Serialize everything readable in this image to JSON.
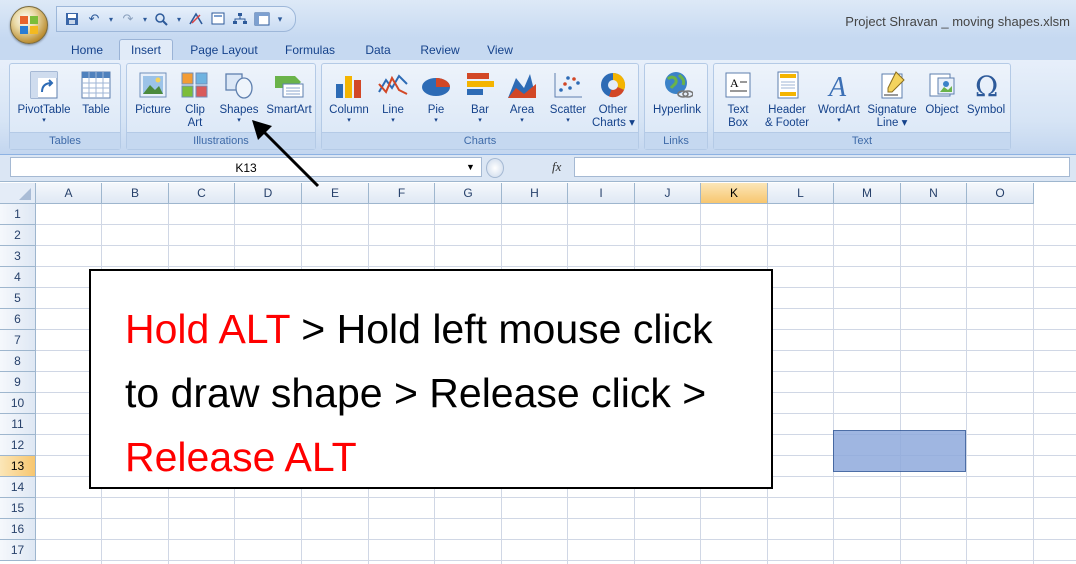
{
  "window": {
    "title": "Project Shravan _ moving shapes.xlsm",
    "quick_access": [
      "save-icon",
      "undo-icon",
      "redo-icon",
      "spelling-icon",
      "sort-icon",
      "print-preview-icon",
      "org-chart-icon",
      "freeze-panes-icon"
    ]
  },
  "tabs": [
    "Home",
    "Insert",
    "Page Layout",
    "Formulas",
    "Data",
    "Review",
    "View"
  ],
  "active_tab": "Insert",
  "ribbon": {
    "tables": {
      "label": "Tables",
      "pivottable": "PivotTable",
      "table": "Table"
    },
    "illustrations": {
      "label": "Illustrations",
      "picture": "Picture",
      "clipart_1": "Clip",
      "clipart_2": "Art",
      "shapes": "Shapes",
      "smartart": "SmartArt"
    },
    "charts": {
      "label": "Charts",
      "column": "Column",
      "line": "Line",
      "pie": "Pie",
      "bar": "Bar",
      "area": "Area",
      "scatter": "Scatter",
      "other_1": "Other",
      "other_2": "Charts"
    },
    "links": {
      "label": "Links",
      "hyperlink": "Hyperlink"
    },
    "text": {
      "label": "Text",
      "textbox_1": "Text",
      "textbox_2": "Box",
      "header_1": "Header",
      "header_2": "& Footer",
      "wordart": "WordArt",
      "signature_1": "Signature",
      "signature_2": "Line",
      "object": "Object",
      "symbol": "Symbol"
    }
  },
  "formula_bar": {
    "name_box": "K13",
    "fx": "fx",
    "formula": ""
  },
  "grid": {
    "columns": [
      "A",
      "B",
      "C",
      "D",
      "E",
      "F",
      "G",
      "H",
      "I",
      "J",
      "K",
      "L",
      "M",
      "N",
      "O"
    ],
    "rows": [
      "1",
      "2",
      "3",
      "4",
      "5",
      "6",
      "7",
      "8",
      "9",
      "10",
      "11",
      "12",
      "13",
      "14",
      "15",
      "16",
      "17"
    ],
    "selected_cell": "K13"
  },
  "callout": {
    "line1_red": "Hold ALT",
    "line1_rest": " > Hold left mouse click",
    "line2": "to draw shape > Release click >",
    "line3_red": "Release ALT"
  },
  "colors": {
    "accent_red": "#ff0000",
    "shape_fill": "#8faadc",
    "selection": "#f7c66f"
  }
}
